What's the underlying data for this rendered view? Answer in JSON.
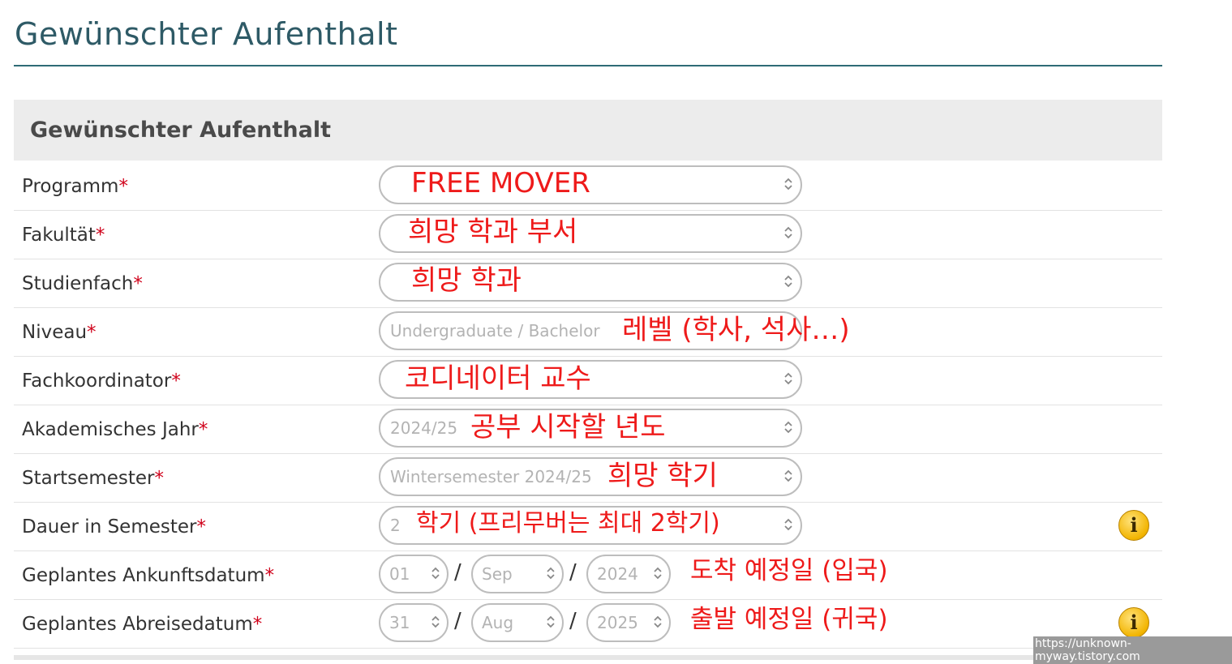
{
  "page": {
    "title": "Gewünschter Aufenthalt"
  },
  "section": {
    "header": "Gewünschter Aufenthalt"
  },
  "required_marker": "*",
  "fields": {
    "programm": {
      "label": "Programm",
      "placeholder": "",
      "annotation": "FREE MOVER"
    },
    "fakultaet": {
      "label": "Fakultät",
      "placeholder": "",
      "annotation": "희망 학과 부서"
    },
    "studienfach": {
      "label": "Studienfach",
      "placeholder": "",
      "annotation": "희망 학과"
    },
    "niveau": {
      "label": "Niveau",
      "placeholder": "Undergraduate / Bachelor",
      "annotation": "레벨 (학사, 석사…)"
    },
    "koordinator": {
      "label": "Fachkoordinator",
      "placeholder": "",
      "annotation": "코디네이터 교수"
    },
    "jahr": {
      "label": "Akademisches Jahr",
      "placeholder": "2024/25",
      "annotation": "공부 시작할 년도"
    },
    "semester": {
      "label": "Startsemester",
      "placeholder": "Wintersemester 2024/25",
      "annotation": "희망 학기"
    },
    "dauer": {
      "label": "Dauer in Semester",
      "placeholder": "2",
      "annotation": "학기 (프리무버는 최대 2학기)"
    },
    "ankunft": {
      "label": "Geplantes Ankunftsdatum",
      "day": "01",
      "month": "Sep",
      "year": "2024",
      "annotation": "도착 예정일 (입국)"
    },
    "abreise": {
      "label": "Geplantes Abreisedatum",
      "day": "31",
      "month": "Aug",
      "year": "2025",
      "annotation": "출발 예정일 (귀국)"
    }
  },
  "date_separator": "/",
  "info_icon_glyph": "i",
  "watermark": "https://unknown-myway.tistory.com",
  "colors": {
    "annotation": "#ee1a1a",
    "required": "#d0021b",
    "title": "#2e5a66"
  }
}
